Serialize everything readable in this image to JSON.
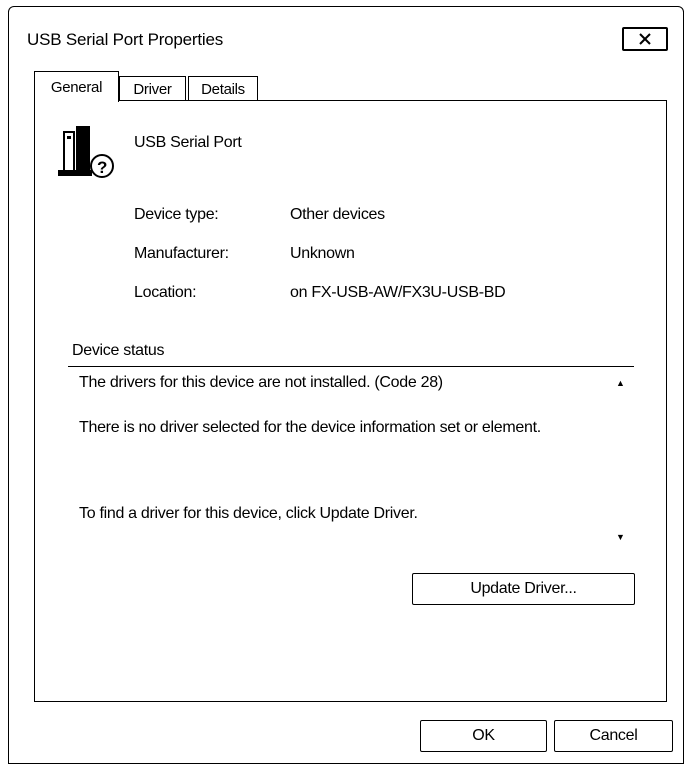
{
  "window": {
    "title": "USB Serial Port Properties",
    "close_icon": "close-icon"
  },
  "tabs": [
    {
      "label": "General",
      "active": true
    },
    {
      "label": "Driver",
      "active": false
    },
    {
      "label": "Details",
      "active": false
    }
  ],
  "device": {
    "icon": "serial-port-unknown-icon",
    "name": "USB Serial Port",
    "properties": [
      {
        "label": "Device type:",
        "value": "Other devices"
      },
      {
        "label": "Manufacturer:",
        "value": "Unknown"
      },
      {
        "label": "Location:",
        "value": "on FX-USB-AW/FX3U-USB-BD"
      }
    ]
  },
  "status": {
    "legend": "Device status",
    "lines": [
      "The drivers for this device are not installed. (Code 28)",
      "There is no driver selected for the device information set or element.",
      "To find a driver for this device, click Update Driver."
    ]
  },
  "buttons": {
    "update_driver": "Update Driver...",
    "ok": "OK",
    "cancel": "Cancel"
  }
}
